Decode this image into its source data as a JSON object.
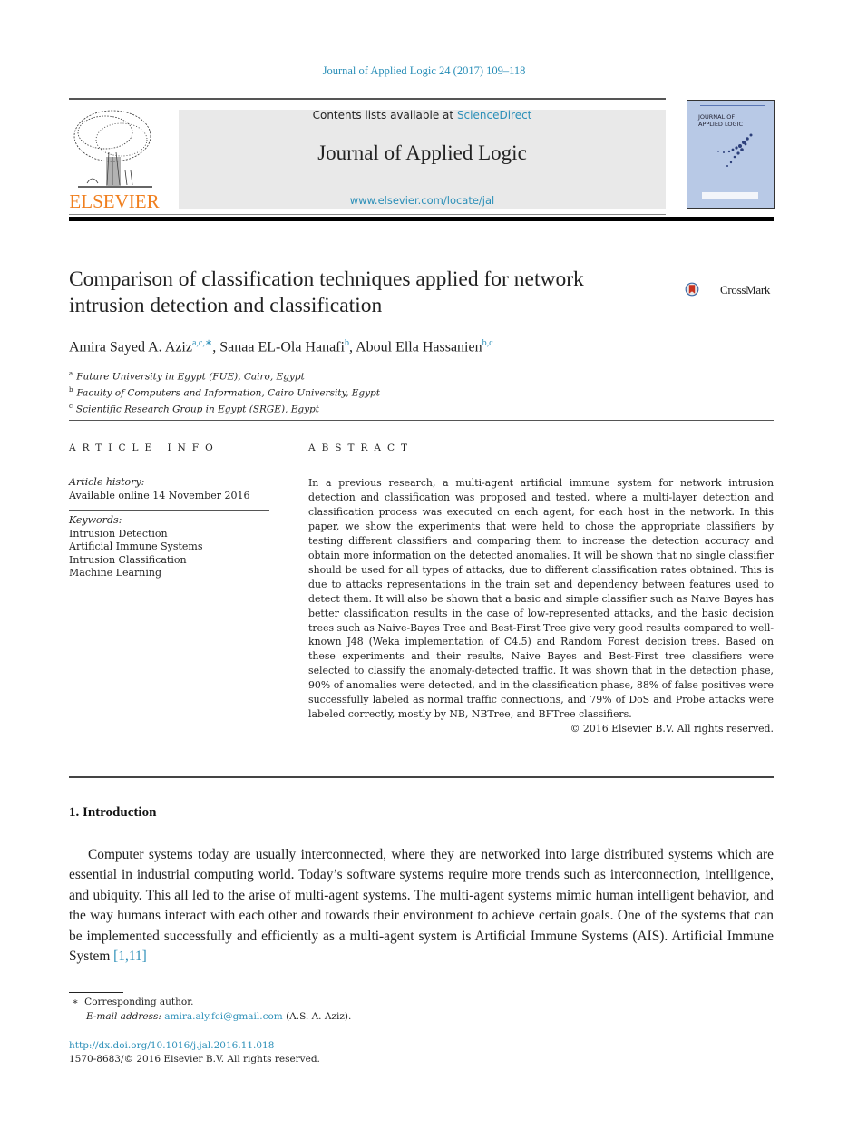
{
  "header": {
    "journal_reference": "Journal of Applied Logic 24 (2017) 109–118",
    "contents_prefix": "Contents lists available at ",
    "contents_link": "ScienceDirect",
    "journal_title": "Journal of Applied Logic",
    "journal_url": "www.elsevier.com/locate/jal",
    "publisher_logo_text": "ELSEVIER",
    "cover_title_line1": "JOURNAL OF",
    "cover_title_line2": "APPLIED LOGIC"
  },
  "colors": {
    "link": "#2b8fb8",
    "elsevier_orange": "#f07f1e",
    "masthead_bg": "#e9e9e9",
    "cover_bg": "#b8c9e6"
  },
  "article": {
    "title": "Comparison of classification techniques applied for network intrusion detection and classification",
    "crossmark_label": "CrossMark",
    "authors": [
      {
        "name": "Amira Sayed A. Aziz",
        "affil": "a,c,∗",
        "sep": ", "
      },
      {
        "name": "Sanaa EL-Ola Hanafi",
        "affil": "b",
        "sep": ", "
      },
      {
        "name": "Aboul Ella Hassanien",
        "affil": "b,c",
        "sep": ""
      }
    ],
    "affiliations": [
      {
        "mark": "a",
        "text": "Future University in Egypt (FUE), Cairo, Egypt"
      },
      {
        "mark": "b",
        "text": "Faculty of Computers and Information, Cairo University, Egypt"
      },
      {
        "mark": "c",
        "text": "Scientific Research Group in Egypt (SRGE), Egypt"
      }
    ]
  },
  "article_info": {
    "heading": "ARTICLE INFO",
    "history_label": "Article history:",
    "history_value": "Available online 14 November 2016",
    "keywords_label": "Keywords:",
    "keywords": [
      "Intrusion Detection",
      "Artificial Immune Systems",
      "Intrusion Classification",
      "Machine Learning"
    ]
  },
  "abstract": {
    "heading": "ABSTRACT",
    "text": "In a previous research, a multi-agent artificial immune system for network intrusion detection and classification was proposed and tested, where a multi-layer detection and classification process was executed on each agent, for each host in the network. In this paper, we show the experiments that were held to chose the appropriate classifiers by testing different classifiers and comparing them to increase the detection accuracy and obtain more information on the detected anomalies. It will be shown that no single classifier should be used for all types of attacks, due to different classification rates obtained. This is due to attacks representations in the train set and dependency between features used to detect them. It will also be shown that a basic and simple classifier such as Naive Bayes has better classification results in the case of low-represented attacks, and the basic decision trees such as Naive-Bayes Tree and Best-First Tree give very good results compared to well-known J48 (Weka implementation of C4.5) and Random Forest decision trees. Based on these experiments and their results, Naive Bayes and Best-First tree classifiers were selected to classify the anomaly-detected traffic. It was shown that in the detection phase, 90% of anomalies were detected, and in the classification phase, 88% of false positives were successfully labeled as normal traffic connections, and 79% of DoS and Probe attacks were labeled correctly, mostly by NB, NBTree, and BFTree classifiers.",
    "copyright": "© 2016 Elsevier B.V. All rights reserved."
  },
  "introduction": {
    "heading": "1.  Introduction",
    "paragraph": "Computer systems today are usually interconnected, where they are networked into large distributed systems which are essential in industrial computing world. Today’s software systems require more trends such as interconnection, intelligence, and ubiquity. This all led to the arise of multi-agent systems. The multi-agent systems mimic human intelligent behavior, and the way humans interact with each other and towards their environment to achieve certain goals. One of the systems that can be implemented successfully and efficiently as a multi-agent system is Artificial Immune Systems (AIS). Artificial Immune System ",
    "citation": "[1,11]"
  },
  "footnotes": {
    "star": "∗",
    "corresponding": "Corresponding author.",
    "email_label": "E-mail address:",
    "email": "amira.aly.fci@gmail.com",
    "email_suffix": " (A.S. A. Aziz).",
    "doi": "http://dx.doi.org/10.1016/j.jal.2016.11.018",
    "issn_line": "1570-8683/© 2016 Elsevier B.V. All rights reserved."
  }
}
